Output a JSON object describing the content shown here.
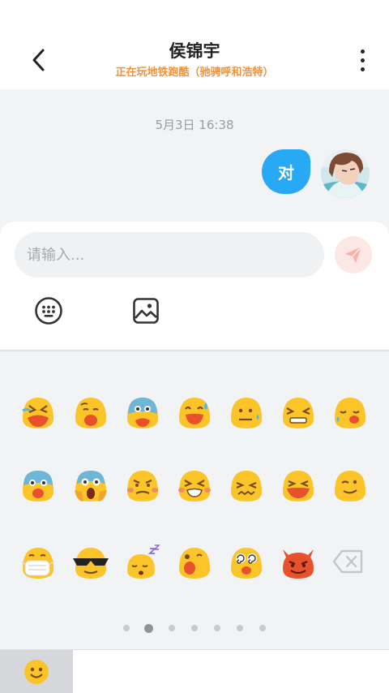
{
  "header": {
    "back_icon": "chevron-left-icon",
    "title": "侯锦宇",
    "status": "正在玩地铁跑酷（驰骋呼和浩特）",
    "menu_icon": "more-vertical-icon"
  },
  "chat": {
    "timestamp": "5月3日 16:38",
    "messages": [
      {
        "text": "对",
        "from": "me",
        "bubble_color": "#28a9f6"
      }
    ]
  },
  "composer": {
    "placeholder": "请输入...",
    "value": "",
    "send_icon": "paper-plane-icon",
    "tools": [
      {
        "name": "keyboard-icon"
      },
      {
        "name": "image-icon"
      }
    ]
  },
  "emoji_panel": {
    "rows": [
      [
        "loudly-crying",
        "sleepy",
        "anxious-sweat",
        "grinning-sweat",
        "expressionless-sweat",
        "persevering",
        "disappointed-relieved"
      ],
      [
        "fearful",
        "screaming",
        "angry",
        "tired",
        "confounded",
        "squinting-tongue",
        "winking"
      ],
      [
        "medical-mask",
        "sunglasses",
        "sleeping",
        "open-mouth",
        "dizzy",
        "devil",
        "backspace"
      ]
    ],
    "page_count": 7,
    "current_page": 2
  },
  "bottom_bar": {
    "tab_icon": "smiley-icon"
  },
  "colors": {
    "accent": "#28a9f6",
    "status": "#f0923a",
    "emoji_yellow": "#fbc52a",
    "devil_red": "#e8512b"
  }
}
